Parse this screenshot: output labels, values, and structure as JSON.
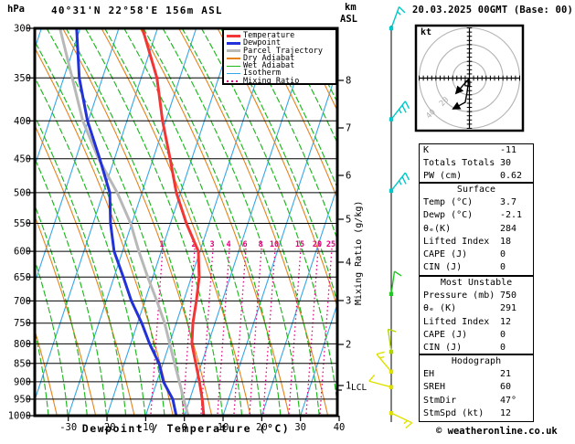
{
  "header": {
    "pressure_unit": "hPa",
    "title": "40°31'N 22°58'E 156m ASL",
    "altitude_unit": "km",
    "altitude_unit2": "ASL",
    "datetime": "20.03.2025 00GMT (Base: 00)"
  },
  "legend": {
    "items": [
      {
        "label": "Temperature",
        "color": "#f23535",
        "thick": 3,
        "dash": ""
      },
      {
        "label": "Dewpoint",
        "color": "#2231d8",
        "thick": 3,
        "dash": ""
      },
      {
        "label": "Parcel Trajectory",
        "color": "#b8b8b8",
        "thick": 3,
        "dash": ""
      },
      {
        "label": "Dry Adiabat",
        "color": "#e6831c",
        "thick": 1.2,
        "dash": ""
      },
      {
        "label": "Wet Adiabat",
        "color": "#1cb81c",
        "thick": 1.2,
        "dash": ""
      },
      {
        "label": "Isotherm",
        "color": "#35a7e8",
        "thick": 1.2,
        "dash": ""
      },
      {
        "label": "Mixing Ratio",
        "color": "#e60080",
        "thick": 1.5,
        "dash": "2 3"
      }
    ]
  },
  "axes": {
    "pressure_ticks": [
      300,
      350,
      400,
      450,
      500,
      550,
      600,
      650,
      700,
      750,
      800,
      850,
      900,
      950,
      1000
    ],
    "temp_ticks": [
      -30,
      -20,
      -10,
      0,
      10,
      20,
      30,
      40
    ],
    "temp_label": "Dewpoint / Temperature (°C)",
    "km_ticks": [
      8,
      7,
      6,
      5,
      4,
      3,
      2,
      1
    ],
    "lcl_label": "LCL",
    "mixing_label": "Mixing Ratio (g/kg)",
    "mixing_values": [
      "1",
      "2",
      "3",
      "4",
      "6",
      "8",
      "10",
      "15",
      "20",
      "25"
    ]
  },
  "wind_barbs": [
    {
      "pressure_hPa": 300,
      "color": "#00c8c8",
      "angle": 20,
      "full": 1,
      "half": 1
    },
    {
      "pressure_hPa": 398,
      "color": "#00c8c8",
      "angle": 38,
      "full": 2,
      "half": 1
    },
    {
      "pressure_hPa": 497,
      "color": "#00c8c8",
      "angle": 38,
      "full": 2,
      "half": 1
    },
    {
      "pressure_hPa": 685,
      "color": "#22c822",
      "angle": 8,
      "full": 1,
      "half": 0
    },
    {
      "pressure_hPa": 820,
      "color": "#b4d400",
      "angle": -8,
      "full": 1,
      "half": 0
    },
    {
      "pressure_hPa": 872,
      "color": "#e0e000",
      "angle": -40,
      "full": 1,
      "half": 1
    },
    {
      "pressure_hPa": 915,
      "color": "#e0e000",
      "angle": -75,
      "full": 1,
      "half": 0
    },
    {
      "pressure_hPa": 992,
      "color": "#e0e000",
      "angle": 115,
      "full": 1,
      "half": 1
    }
  ],
  "hodograph": {
    "unit_label": "kt",
    "ring_labels": [
      "20",
      "40"
    ],
    "trace1_kt": [
      [
        0,
        0
      ],
      [
        -4.6,
        -5.2
      ],
      [
        -7.9,
        -9.0
      ]
    ],
    "trace2_kt": [
      [
        -0.3,
        -0.5
      ],
      [
        -1.4,
        -8.5
      ],
      [
        -2.5,
        -14.5
      ],
      [
        -9.6,
        -18.3
      ]
    ],
    "marker_kt": [
      -1.2,
      -3.2
    ]
  },
  "table": {
    "sections": [
      {
        "header": "",
        "rows": [
          [
            "K",
            "-11"
          ],
          [
            "Totals Totals",
            "30"
          ],
          [
            "PW (cm)",
            "0.62"
          ]
        ]
      },
      {
        "header": "Surface",
        "rows": [
          [
            "Temp (°C)",
            "3.7"
          ],
          [
            "Dewp (°C)",
            "-2.1"
          ],
          [
            "θₑ(K)",
            "284"
          ],
          [
            "Lifted Index",
            "18"
          ],
          [
            "CAPE (J)",
            "0"
          ],
          [
            "CIN (J)",
            "0"
          ]
        ]
      },
      {
        "header": "Most Unstable",
        "rows": [
          [
            "Pressure (mb)",
            "750"
          ],
          [
            "θₑ (K)",
            "291"
          ],
          [
            "Lifted Index",
            "12"
          ],
          [
            "CAPE (J)",
            "0"
          ],
          [
            "CIN (J)",
            "0"
          ]
        ]
      },
      {
        "header": "Hodograph",
        "rows": [
          [
            "EH",
            "21"
          ],
          [
            "SREH",
            "60"
          ],
          [
            "StmDir",
            "47°"
          ],
          [
            "StmSpd (kt)",
            "12"
          ]
        ]
      }
    ]
  },
  "footer": {
    "copyright": "© weatheronline.co.uk"
  },
  "chart_data": {
    "type": "skewt_logp_sounding",
    "title": "40°31'N 22°58'E 156m ASL",
    "valid_time": "20.03.2025 00GMT (Base: 00)",
    "pressure_axis": {
      "unit": "hPa",
      "scale": "log",
      "min": 300,
      "max": 1000,
      "ticks": [
        300,
        350,
        400,
        450,
        500,
        550,
        600,
        650,
        700,
        750,
        800,
        850,
        900,
        950,
        1000
      ]
    },
    "temp_axis": {
      "unit": "°C",
      "label": "Dewpoint / Temperature (°C)",
      "ticks": [
        -30,
        -20,
        -10,
        0,
        10,
        20,
        30,
        40
      ]
    },
    "altitude_axis": {
      "unit": "km ASL",
      "ticks": [
        1,
        2,
        3,
        4,
        5,
        6,
        7,
        8
      ],
      "lcl_km": 1
    },
    "mixing_ratio_lines_gkg": [
      1,
      2,
      3,
      4,
      6,
      8,
      10,
      15,
      20,
      25
    ],
    "series": {
      "pressure_hPa": [
        300,
        350,
        400,
        450,
        500,
        550,
        600,
        650,
        700,
        750,
        800,
        850,
        900,
        950,
        1000
      ],
      "temperature_C": [
        -43.9,
        -35.9,
        -30.8,
        -25.6,
        -21.1,
        -15.9,
        -10.4,
        -8.0,
        -6.7,
        -5.7,
        -4.2,
        -1.5,
        1.0,
        3.2,
        5.0
      ],
      "dewpoint_C": [
        -60.9,
        -56.0,
        -50.2,
        -43.8,
        -38.3,
        -35.5,
        -32.2,
        -27.6,
        -23.5,
        -18.9,
        -15.1,
        -11.0,
        -8.3,
        -4.4,
        -2.1
      ],
      "parcel_C": [
        -65.2,
        -57.8,
        -51.4,
        -44.1,
        -36.4,
        -30.3,
        -25.8,
        -21.3,
        -16.9,
        -13.0,
        -9.9,
        -7.0,
        -4.2,
        -1.6,
        1.0
      ]
    },
    "background": {
      "isotherm_step_C": 10,
      "dry_adiabat_step_C": 10,
      "wet_adiabat_step_C": 5,
      "grid": "pressure-levels"
    },
    "indices": {
      "K": -11,
      "Totals_Totals": 30,
      "PW_cm": 0.62,
      "surface": {
        "temp_C": 3.7,
        "dewp_C": -2.1,
        "theta_e_K": 284,
        "lifted_index": 18,
        "CAPE_J": 0,
        "CIN_J": 0
      },
      "most_unstable": {
        "pressure_mb": 750,
        "theta_e_K": 291,
        "lifted_index": 12,
        "CAPE_J": 0,
        "CIN_J": 0
      },
      "hodograph": {
        "EH": 21,
        "SREH": 60,
        "StmDir_deg": 47,
        "StmSpd_kt": 12
      }
    }
  }
}
